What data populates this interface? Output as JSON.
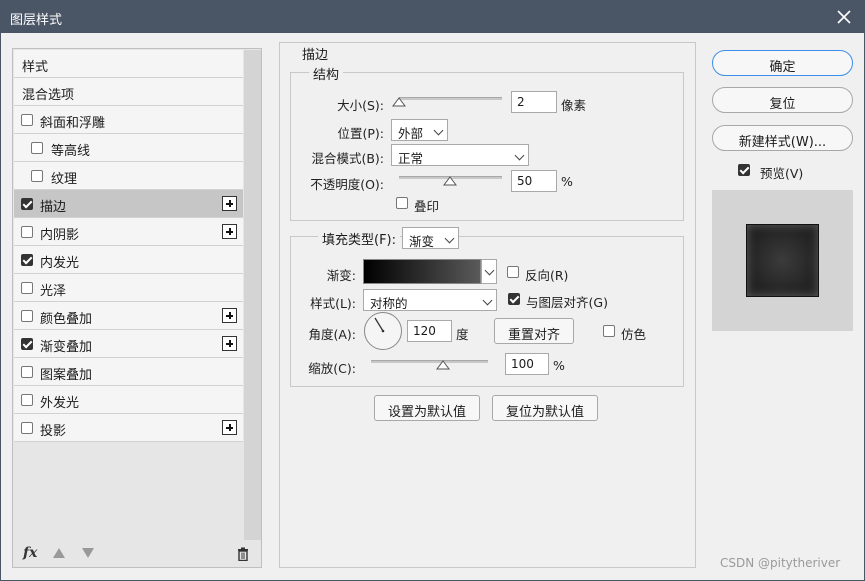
{
  "window": {
    "title": "图层样式",
    "close_icon": "close-icon"
  },
  "left": {
    "items": [
      {
        "label": "样式",
        "checkbox": false,
        "checked": false,
        "plus": false,
        "selected": false
      },
      {
        "label": "混合选项",
        "checkbox": false,
        "checked": false,
        "plus": false,
        "selected": false
      },
      {
        "label": "斜面和浮雕",
        "checkbox": true,
        "checked": false,
        "plus": false,
        "selected": false
      },
      {
        "label": "等高线",
        "checkbox": true,
        "checked": false,
        "plus": false,
        "selected": false,
        "indent": true
      },
      {
        "label": "纹理",
        "checkbox": true,
        "checked": false,
        "plus": false,
        "selected": false,
        "indent": true
      },
      {
        "label": "描边",
        "checkbox": true,
        "checked": true,
        "plus": true,
        "selected": true
      },
      {
        "label": "内阴影",
        "checkbox": true,
        "checked": false,
        "plus": true,
        "selected": false
      },
      {
        "label": "内发光",
        "checkbox": true,
        "checked": true,
        "plus": false,
        "selected": false
      },
      {
        "label": "光泽",
        "checkbox": true,
        "checked": false,
        "plus": false,
        "selected": false
      },
      {
        "label": "颜色叠加",
        "checkbox": true,
        "checked": false,
        "plus": true,
        "selected": false
      },
      {
        "label": "渐变叠加",
        "checkbox": true,
        "checked": true,
        "plus": true,
        "selected": false
      },
      {
        "label": "图案叠加",
        "checkbox": true,
        "checked": false,
        "plus": false,
        "selected": false
      },
      {
        "label": "外发光",
        "checkbox": true,
        "checked": false,
        "plus": false,
        "selected": false
      },
      {
        "label": "投影",
        "checkbox": true,
        "checked": false,
        "plus": true,
        "selected": false
      }
    ],
    "footer": {
      "fx_label": "fx"
    }
  },
  "stroke": {
    "section_title": "描边",
    "structure_title": "结构",
    "size_label": "大小(S):",
    "size_value": "2",
    "size_unit": "像素",
    "position_label": "位置(P):",
    "position_value": "外部",
    "blend_label": "混合模式(B):",
    "blend_value": "正常",
    "opacity_label": "不透明度(O):",
    "opacity_value": "50",
    "opacity_unit": "%",
    "overprint_label": "叠印",
    "overprint_checked": false,
    "fill_type_label": "填充类型(F):",
    "fill_type_value": "渐变",
    "gradient_label": "渐变:",
    "reverse_label": "反向(R)",
    "reverse_checked": false,
    "style_label": "样式(L):",
    "style_value": "对称的",
    "align_label": "与图层对齐(G)",
    "align_checked": true,
    "angle_label": "角度(A):",
    "angle_value": "120",
    "angle_unit": "度",
    "reset_align_button": "重置对齐",
    "dither_label": "仿色",
    "dither_checked": false,
    "scale_label": "缩放(C):",
    "scale_value": "100",
    "scale_unit": "%",
    "make_default_button": "设置为默认值",
    "reset_default_button": "复位为默认值"
  },
  "right": {
    "ok_button": "确定",
    "reset_button": "复位",
    "new_style_button": "新建样式(W)...",
    "preview_label": "预览(V)",
    "preview_checked": true
  },
  "watermark": "CSDN @pitytheriver",
  "colors": {
    "titlebar": "#4a5565",
    "accent": "#3d8eeb",
    "selected_row": "#c6c6c6"
  }
}
